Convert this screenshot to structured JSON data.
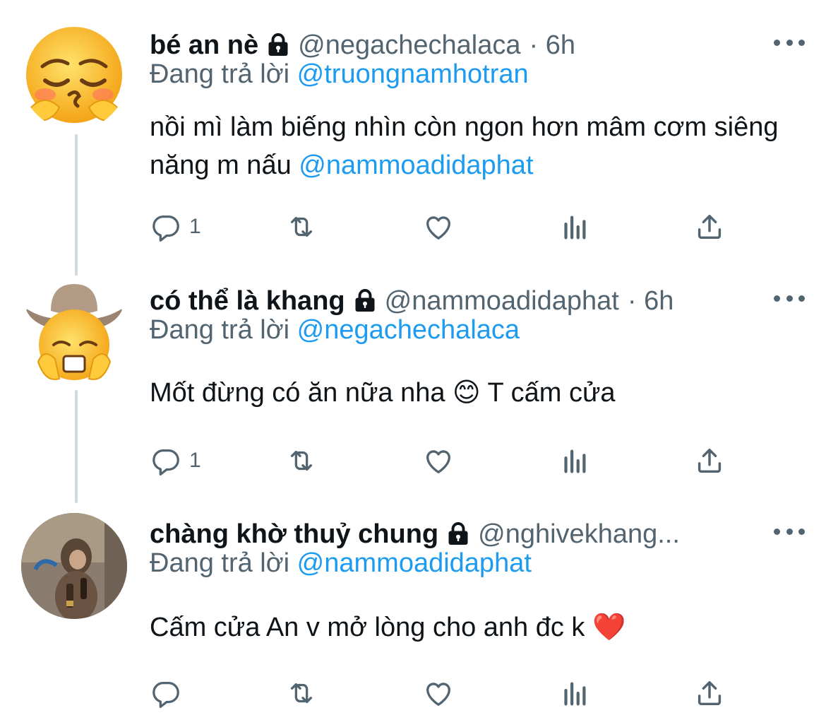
{
  "tweets": [
    {
      "name": "bé an nè",
      "handle": "@negachechalaca",
      "time": "· 6h",
      "replying_prefix": "Đang trả lời",
      "replying_to": "@truongnamhotran",
      "text_plain": "nồi mì làm biếng nhìn còn ngon hơn mâm cơm siêng năng m nấu",
      "text_mention": "@nammoadidaphat",
      "reply_count": "1",
      "avatar_icon": "pleading-face-emoji-icon"
    },
    {
      "name": "có thể là khang",
      "handle": "@nammoadidaphat",
      "time": "· 6h",
      "replying_prefix": "Đang trả lời",
      "replying_to": "@negachechalaca",
      "text_before": "Mốt đừng có ăn nữa nha",
      "text_emoji": "😊",
      "text_after": "T cấm cửa",
      "reply_count": "1",
      "avatar_icon": "cowboy-emoji-icon"
    },
    {
      "name": "chàng khờ thuỷ chung",
      "handle": "@nghivekhang...",
      "time": "",
      "replying_prefix": "Đang trả lời",
      "replying_to": "@nammoadidaphat",
      "text_before": "Cấm cửa An v mở lòng cho anh đc k",
      "text_emoji": "❤️",
      "reply_count": "",
      "avatar_icon": "monkey-photo-avatar"
    }
  ],
  "colors": {
    "text": "#0f1419",
    "secondary": "#536471",
    "accent": "#1d9bf0",
    "thread_line": "#cfd9de"
  },
  "icons": [
    "reply-icon",
    "retweet-icon",
    "like-icon",
    "analytics-icon",
    "share-icon",
    "more-icon",
    "lock-icon"
  ]
}
